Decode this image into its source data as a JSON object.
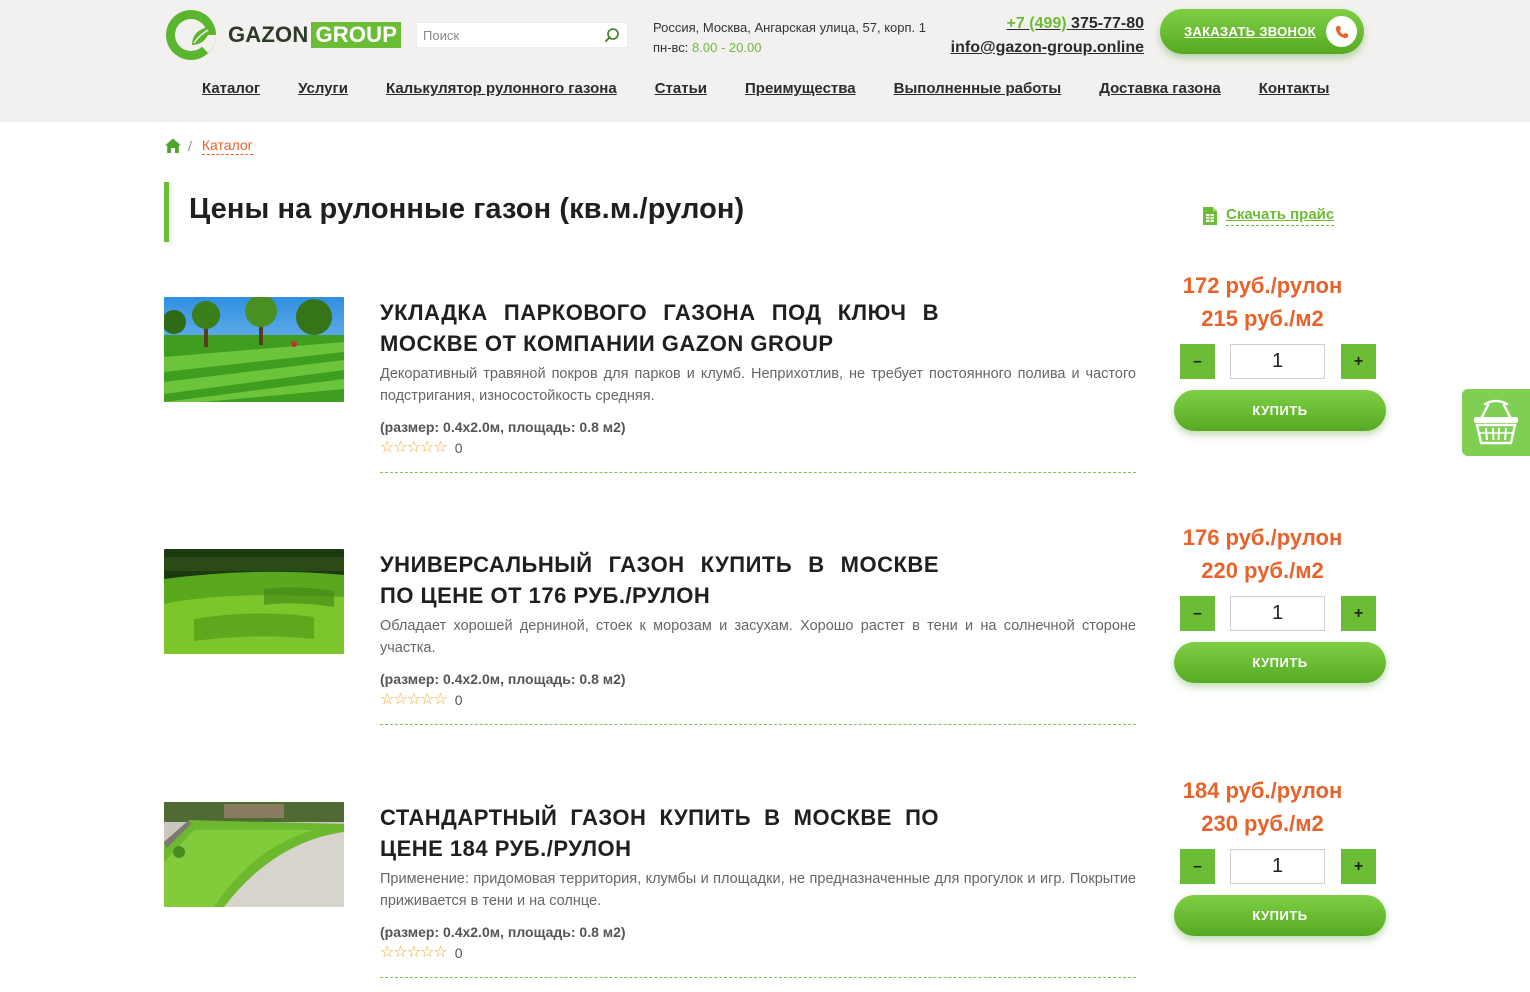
{
  "header": {
    "logo": {
      "word1": "GAZON",
      "word2": "GROUP"
    },
    "search": {
      "placeholder": "Поиск",
      "value": ""
    },
    "address": {
      "line1": "Россия, Москва, Ангарская улица, 57, корп. 1",
      "hours_label": "пн-вс:",
      "hours_value": "8.00 - 20.00"
    },
    "phone": {
      "code": "+7 (499)",
      "number": "375-77-80"
    },
    "email": "info@gazon-group.online",
    "callback_label": "ЗАКАЗАТЬ ЗВОНОК"
  },
  "nav": [
    {
      "label": "Каталог"
    },
    {
      "label": "Услуги"
    },
    {
      "label": "Калькулятор рулонного газона"
    },
    {
      "label": "Статьи"
    },
    {
      "label": "Преимущества"
    },
    {
      "label": "Выполненные работы"
    },
    {
      "label": "Доставка газона"
    },
    {
      "label": "Контакты"
    }
  ],
  "breadcrumb": {
    "separator": "/",
    "current": "Каталог"
  },
  "page_title": "Цены на рулонные газон (кв.м./рулон)",
  "download_label": "Скачать прайс",
  "products": [
    {
      "title": "Укладка паркового газона под ключ в Москве от компании GAZON GROUP",
      "description": "Декоративный травяной покров для парков и клумб. Неприхотлив, не требует постоянного полива и частого подстригания, износостойкость средняя.",
      "size": "(размер: 0.4х2.0м, площадь: 0.8 м2)",
      "rating_count": "0",
      "price_roll": "172 руб./рулон",
      "price_m2": "215 руб./м2",
      "quantity": "1",
      "minus": "–",
      "plus": "+",
      "buy_label": "КУПИТЬ"
    },
    {
      "title": "Универсальный газон купить в Москве по цене от 176 руб./рулон",
      "description": "Обладает хорошей дерниной, стоек к морозам и засухам. Хорошо растет в тени и на солнечной стороне участка.",
      "size": "(размер: 0.4х2.0м, площадь: 0.8 м2)",
      "rating_count": "0",
      "price_roll": "176 руб./рулон",
      "price_m2": "220 руб./м2",
      "quantity": "1",
      "minus": "–",
      "plus": "+",
      "buy_label": "КУПИТЬ"
    },
    {
      "title": "Стандартный газон купить в Москве по цене 184 руб./рулон",
      "description": "Применение: придомовая территория, клумбы и площадки, не предназначенные для прогулок и игр. Покрытие приживается в тени и на солнце.",
      "size": "(размер: 0.4х2.0м, площадь: 0.8 м2)",
      "rating_count": "0",
      "price_roll": "184 руб./рулон",
      "price_m2": "230 руб./м2",
      "quantity": "1",
      "minus": "–",
      "plus": "+",
      "buy_label": "КУПИТЬ"
    }
  ],
  "colors": {
    "brand_green": "#6cbd36",
    "price_orange": "#e8622b",
    "header_bg": "#f2f1ef",
    "star": "#f0a623"
  },
  "icons": [
    "logo-leaf-icon",
    "search-icon",
    "phone-icon",
    "home-icon",
    "xls-file-icon",
    "star-icon",
    "basket-icon"
  ]
}
